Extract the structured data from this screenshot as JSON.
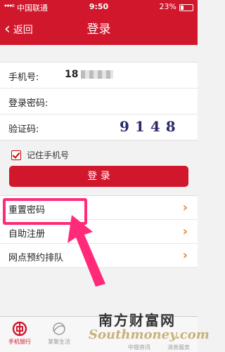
{
  "status_bar": {
    "carrier": "中国联通",
    "time": "9:50",
    "battery": "23%"
  },
  "nav": {
    "back_label": "返回",
    "title": "登录"
  },
  "form": {
    "phone_label": "手机号:",
    "phone_value": "18",
    "password_label": "登录密码:",
    "captcha_label": "验证码:",
    "captcha_text": "9148"
  },
  "remember_label": "记住手机号",
  "login_button": "登 录",
  "menu": [
    {
      "label": "重置密码"
    },
    {
      "label": "自助注册"
    },
    {
      "label": "网点预约排队"
    }
  ],
  "tabs": [
    {
      "label": "手机银行",
      "active": true
    },
    {
      "label": "掌聚生活",
      "active": false
    },
    {
      "label": "中银资讯",
      "active": false
    },
    {
      "label": "消息服务",
      "active": false
    }
  ],
  "watermark": {
    "cn": "南方财富网",
    "en": "Southmoney.com"
  },
  "colors": {
    "brand": "#d0172c",
    "highlight": "#ff2a7a",
    "arrow": "#e88a2a"
  }
}
